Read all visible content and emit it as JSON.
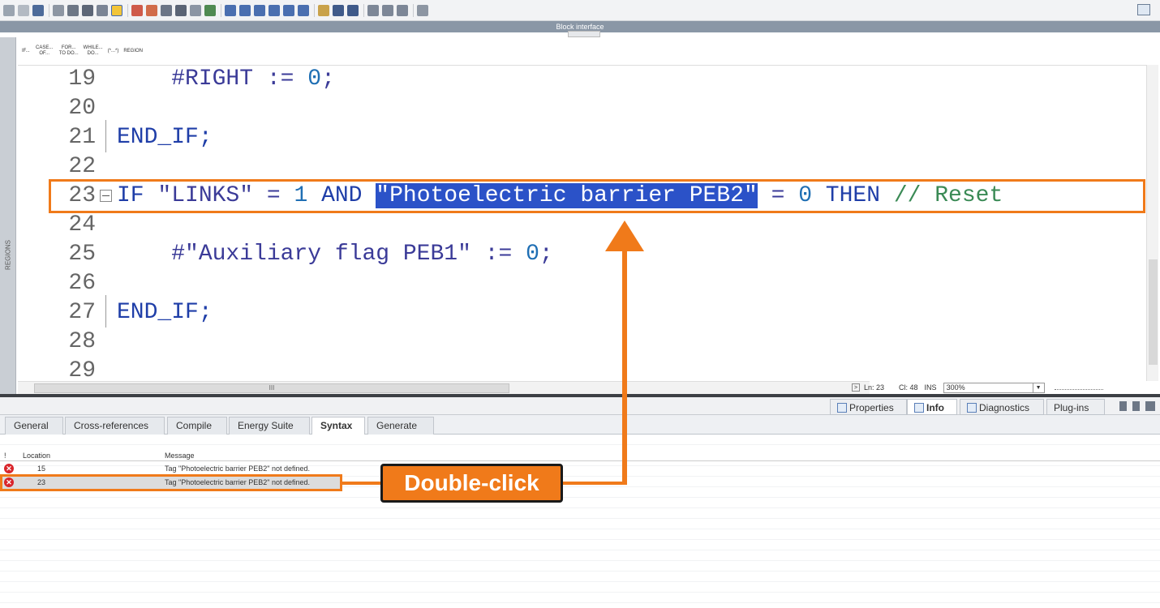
{
  "block_interface_label": "Block interface",
  "regions_label": "REGIONS",
  "snippets": [
    "IF...",
    "CASE... OF...",
    "FOR... TO DO...",
    "WHILE... DO...",
    "(*...*)",
    "REGION"
  ],
  "code_lines": [
    {
      "num": "19",
      "indent": "    ",
      "parts": [
        {
          "t": "#RIGHT := ",
          "c": "plain"
        },
        {
          "t": "0",
          "c": "num"
        },
        {
          "t": ";",
          "c": "plain"
        }
      ]
    },
    {
      "num": "20",
      "indent": "",
      "parts": []
    },
    {
      "num": "21",
      "indent": "",
      "parts": [
        {
          "t": "END_IF;",
          "c": "kw"
        }
      ]
    },
    {
      "num": "22",
      "indent": "",
      "parts": []
    },
    {
      "num": "23",
      "indent": "",
      "parts": [
        {
          "t": "IF ",
          "c": "kw"
        },
        {
          "t": "\"LINKS\" = ",
          "c": "plain"
        },
        {
          "t": "1",
          "c": "num"
        },
        {
          "t": " AND ",
          "c": "kw"
        },
        {
          "t": "\"Photoelectric barrier PEB2\"",
          "c": "sel"
        },
        {
          "t": " = ",
          "c": "plain"
        },
        {
          "t": "0",
          "c": "num"
        },
        {
          "t": " THEN ",
          "c": "kw"
        },
        {
          "t": "// Reset",
          "c": "cm"
        }
      ]
    },
    {
      "num": "24",
      "indent": "",
      "parts": []
    },
    {
      "num": "25",
      "indent": "    ",
      "parts": [
        {
          "t": "#\"Auxiliary flag PEB1\" := ",
          "c": "plain"
        },
        {
          "t": "0",
          "c": "num"
        },
        {
          "t": ";",
          "c": "plain"
        }
      ]
    },
    {
      "num": "26",
      "indent": "",
      "parts": []
    },
    {
      "num": "27",
      "indent": "",
      "parts": [
        {
          "t": "END_IF;",
          "c": "kw"
        }
      ]
    },
    {
      "num": "28",
      "indent": "",
      "parts": []
    },
    {
      "num": "29",
      "indent": "",
      "parts": []
    }
  ],
  "status": {
    "line": "Ln: 23",
    "col": "Cl: 48",
    "mode": "INS",
    "zoom": "300%",
    "hscroll_label": "III"
  },
  "inspector_tabs": [
    {
      "label": "Properties",
      "icon": "properties-icon"
    },
    {
      "label": "Info",
      "icon": "info-icon",
      "active": true
    },
    {
      "label": "Diagnostics",
      "icon": "diagnostics-icon"
    },
    {
      "label": "Plug-ins",
      "icon": ""
    }
  ],
  "sub_tabs": [
    {
      "label": "General"
    },
    {
      "label": "Cross-references"
    },
    {
      "label": "Compile"
    },
    {
      "label": "Energy Suite"
    },
    {
      "label": "Syntax",
      "active": true
    },
    {
      "label": "Generate"
    }
  ],
  "messages_header": {
    "flag": "!",
    "location": "Location",
    "message": "Message"
  },
  "messages": [
    {
      "location": "15",
      "message": "Tag \"Photoelectric barrier PEB2\" not defined."
    },
    {
      "location": "23",
      "message": "Tag \"Photoelectric barrier PEB2\" not defined."
    }
  ],
  "callout": "Double-click",
  "colors": {
    "accent_orange": "#f07a1a",
    "selection_blue": "#2b52c8",
    "keyword_blue": "#1f3ea8",
    "error_red": "#d9252b"
  }
}
